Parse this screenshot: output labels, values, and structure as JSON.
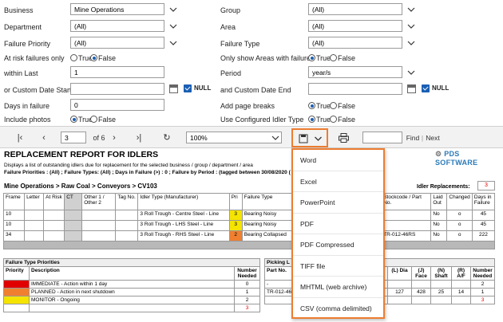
{
  "params": {
    "left": [
      {
        "label": "Business",
        "value": "Mine Operations",
        "kind": "select"
      },
      {
        "label": "Department",
        "value": "(All)",
        "kind": "select"
      },
      {
        "label": "Failure Priority",
        "value": "(All)",
        "kind": "select"
      },
      {
        "label": "At risk failures only",
        "kind": "radio",
        "options": [
          "True",
          "False"
        ],
        "selected": "False"
      },
      {
        "label": "within Last",
        "value": "1",
        "kind": "text"
      },
      {
        "label": "or Custom Date Start",
        "value": "",
        "kind": "date"
      },
      {
        "label": "Days in failure",
        "value": "0",
        "kind": "text"
      },
      {
        "label": "Include photos",
        "kind": "radio",
        "options": [
          "True",
          "False"
        ],
        "selected": "True"
      }
    ],
    "right": [
      {
        "label": "Group",
        "value": "(All)",
        "kind": "select"
      },
      {
        "label": "Area",
        "value": "(All)",
        "kind": "select"
      },
      {
        "label": "Failure Type",
        "value": "(All)",
        "kind": "select"
      },
      {
        "label": "Only show Areas with failures",
        "kind": "radio",
        "options": [
          "True",
          "False"
        ],
        "selected": "True"
      },
      {
        "label": "Period",
        "value": "year/s",
        "kind": "select"
      },
      {
        "label": "and Custom Date End",
        "value": "",
        "kind": "date"
      },
      {
        "label": "Add page breaks",
        "kind": "radio",
        "options": [
          "True",
          "False"
        ],
        "selected": "True"
      },
      {
        "label": "Use Configured Idler Type",
        "kind": "radio",
        "options": [
          "True",
          "False"
        ],
        "selected": "True"
      }
    ],
    "null_label": "NULL"
  },
  "toolbar": {
    "page": "3",
    "of_pages": "of 6",
    "zoom": "100%",
    "find_label": "Find",
    "next_label": "Next",
    "separator": "|"
  },
  "report": {
    "title": "REPLACEMENT REPORT FOR IDLERS",
    "description": "Displays a list of outstanding idlers due for replacement for the selected business / group / department  / area",
    "filter_line": "Failure Priorities : (All) ; Failure Types: (All) ; Days in Failure (>) : 0 ; Failure by Period : (tagged between 30/08/2020 (",
    "logo_text": "PDS SOFTWARE",
    "section_heading": "Mine Operations > Raw Coal > Conveyors > CV103",
    "idler_replacements_label": "Idler Replacements:",
    "idler_replacements_value": "3",
    "columns": [
      "Frame",
      "Letter",
      "At Risk",
      "CT",
      "Other 1 / Other 2",
      "Tag No.",
      "Idler Type (Manufacturer)",
      "Pri",
      "Failure Type",
      "Stockcode / Part No.",
      "Laid Out",
      "Changed",
      "Days in Failure"
    ],
    "rows": [
      {
        "frame": "10",
        "idler": "3 Roll Trough - Centre Steel - Line",
        "pri": "3",
        "failure": "Bearing Noisy",
        "stock": "",
        "laid": "No",
        "changed": "o",
        "days": "45"
      },
      {
        "frame": "10",
        "idler": "3 Roll Trough - LHS Steel - Line",
        "pri": "3",
        "failure": "Bearing Noisy",
        "stock": "",
        "laid": "No",
        "changed": "o",
        "days": "45"
      },
      {
        "frame": "34",
        "idler": "3 Roll Trough - RHS Steel - Line",
        "pri": "2",
        "failure": "Bearing Collapsed",
        "stock": "TR-012-46RS",
        "laid": "No",
        "changed": "o",
        "days": "222"
      }
    ],
    "priorities_heading": "Failure Type Priorities",
    "priorities_columns": [
      "Priority",
      "Description",
      "Number Needed"
    ],
    "priorities": [
      {
        "desc": "IMMEDIATE - Action within 1 day",
        "count": "0",
        "color": "#e00000"
      },
      {
        "desc": "PLANNED - Action in next shutdown",
        "count": "1",
        "color": "#f08030"
      },
      {
        "desc": "MONITOR - Ongoing",
        "count": "2",
        "color": "#f5e400"
      }
    ],
    "priorities_total": "3",
    "picking_heading": "Picking L",
    "picking_columns": [
      "Part No.",
      "(L) Dia",
      "(J) Face",
      "(N) Shaft",
      "(R) A/F",
      "Number Needed"
    ],
    "picking_rows": [
      {
        "part": "-",
        "dia": "",
        "face": "",
        "shaft": "",
        "af": "",
        "count": "2"
      },
      {
        "part": "TR-012-46",
        "dia": "127",
        "face": "428",
        "shaft": "25",
        "af": "14",
        "count": "1"
      }
    ],
    "picking_total": "3"
  },
  "export_menu": {
    "items": [
      "Word",
      "Excel",
      "PowerPoint",
      "PDF",
      "PDF Compressed",
      "TIFF file",
      "MHTML (web archive)",
      "CSV (comma delimited)"
    ]
  },
  "colors": {
    "highlight": "#ed7d31",
    "accent": "#1a5fb4",
    "yellow": "#f5e400",
    "orange": "#f08030",
    "red": "#e00000"
  }
}
